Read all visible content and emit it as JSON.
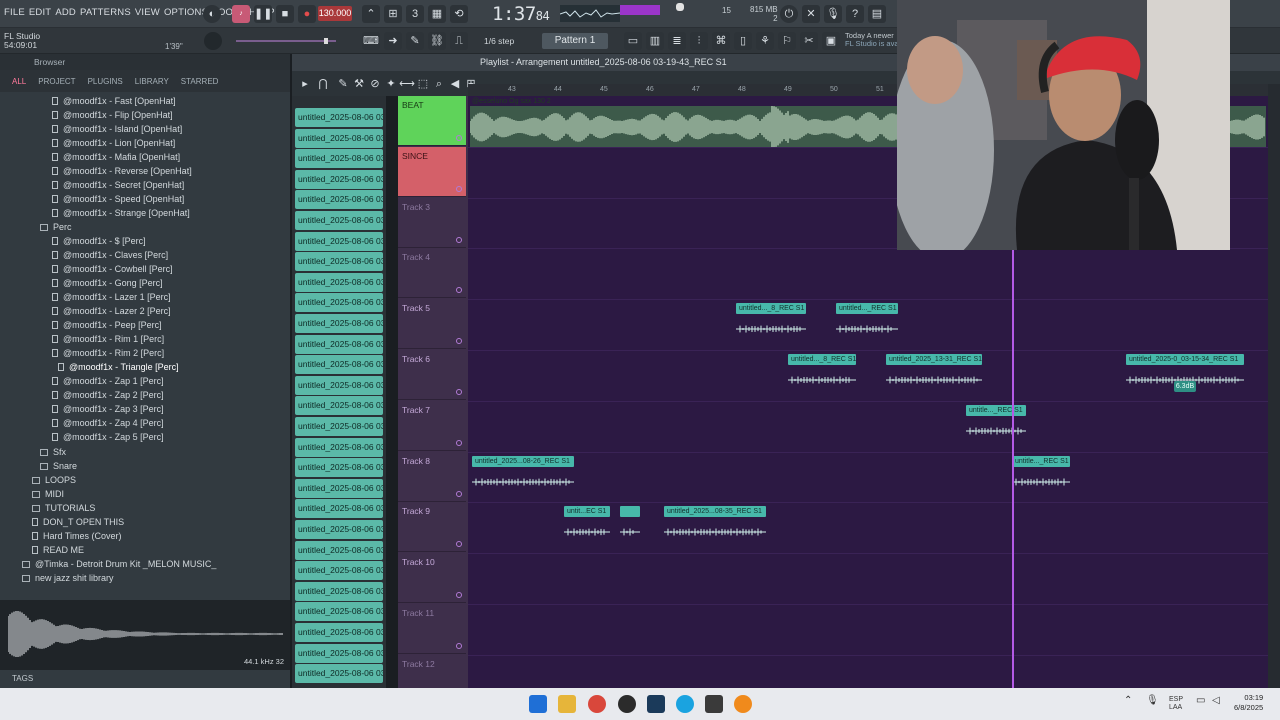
{
  "menu": [
    "FILE",
    "EDIT",
    "ADD",
    "PATTERNS",
    "VIEW",
    "OPTIONS",
    "TOOLS",
    "HELP"
  ],
  "transport": {
    "tempo": "130.000",
    "clock_main": "1:37",
    "clock_frac": "84",
    "mem_top": "815 MB",
    "mem_bottom": "2",
    "val15": "15"
  },
  "project": {
    "app": "FL Studio",
    "time": "54:09:01",
    "hint": "1'39\""
  },
  "toolbar": {
    "step": "1/6 step",
    "pattern": "Pattern 1"
  },
  "news": {
    "line1": "Today  A newer",
    "line2": "FL Studio is ava"
  },
  "browser": {
    "title": "Browser",
    "tabs": [
      "ALL",
      "PROJECT",
      "PLUGINS",
      "LIBRARY",
      "STARRED"
    ],
    "items": [
      {
        "label": "@moodf1x - Fast [OpenHat]",
        "indent": 52,
        "type": "file"
      },
      {
        "label": "@moodf1x - Flip [OpenHat]",
        "indent": 52,
        "type": "file"
      },
      {
        "label": "@moodf1x - Island [OpenHat]",
        "indent": 52,
        "type": "file"
      },
      {
        "label": "@moodf1x - Lion [OpenHat]",
        "indent": 52,
        "type": "file"
      },
      {
        "label": "@moodf1x - Mafia [OpenHat]",
        "indent": 52,
        "type": "file"
      },
      {
        "label": "@moodf1x - Reverse [OpenHat]",
        "indent": 52,
        "type": "file"
      },
      {
        "label": "@moodf1x - Secret [OpenHat]",
        "indent": 52,
        "type": "file"
      },
      {
        "label": "@moodf1x - Speed [OpenHat]",
        "indent": 52,
        "type": "file"
      },
      {
        "label": "@moodf1x - Strange [OpenHat]",
        "indent": 52,
        "type": "file"
      },
      {
        "label": "Perc",
        "indent": 40,
        "type": "folder"
      },
      {
        "label": "@moodf1x - $ [Perc]",
        "indent": 52,
        "type": "file"
      },
      {
        "label": "@moodf1x - Claves [Perc]",
        "indent": 52,
        "type": "file"
      },
      {
        "label": "@moodf1x - Cowbell [Perc]",
        "indent": 52,
        "type": "file"
      },
      {
        "label": "@moodf1x - Gong [Perc]",
        "indent": 52,
        "type": "file"
      },
      {
        "label": "@moodf1x - Lazer 1 [Perc]",
        "indent": 52,
        "type": "file"
      },
      {
        "label": "@moodf1x - Lazer 2 [Perc]",
        "indent": 52,
        "type": "file"
      },
      {
        "label": "@moodf1x - Peep [Perc]",
        "indent": 52,
        "type": "file"
      },
      {
        "label": "@moodf1x - Rim 1 [Perc]",
        "indent": 52,
        "type": "file"
      },
      {
        "label": "@moodf1x - Rim 2 [Perc]",
        "indent": 52,
        "type": "file"
      },
      {
        "label": "@moodf1x - Triangle [Perc]",
        "indent": 58,
        "type": "file",
        "selected": true
      },
      {
        "label": "@moodf1x - Zap 1 [Perc]",
        "indent": 52,
        "type": "file"
      },
      {
        "label": "@moodf1x - Zap 2 [Perc]",
        "indent": 52,
        "type": "file"
      },
      {
        "label": "@moodf1x - Zap 3 [Perc]",
        "indent": 52,
        "type": "file"
      },
      {
        "label": "@moodf1x - Zap 4 [Perc]",
        "indent": 52,
        "type": "file"
      },
      {
        "label": "@moodf1x - Zap 5 [Perc]",
        "indent": 52,
        "type": "file"
      },
      {
        "label": "Sfx",
        "indent": 40,
        "type": "folder"
      },
      {
        "label": "Snare",
        "indent": 40,
        "type": "folder"
      },
      {
        "label": "LOOPS",
        "indent": 32,
        "type": "folder"
      },
      {
        "label": "MIDI",
        "indent": 32,
        "type": "folder"
      },
      {
        "label": "TUTORIALS",
        "indent": 32,
        "type": "folder"
      },
      {
        "label": "DON_T OPEN THIS",
        "indent": 32,
        "type": "file"
      },
      {
        "label": "Hard Times (Cover)",
        "indent": 32,
        "type": "file"
      },
      {
        "label": "READ ME",
        "indent": 32,
        "type": "file"
      },
      {
        "label": "@Timka - Detroit Drum Kit _MELON MUSIC_",
        "indent": 22,
        "type": "folder"
      },
      {
        "label": "new jazz shit library",
        "indent": 22,
        "type": "folder"
      }
    ],
    "preview_rate": "44.1 kHz 32",
    "tags": "TAGS"
  },
  "channels": {
    "label": "untitled_2025-08-06 03-",
    "count": 28
  },
  "playlist": {
    "title": "Playlist - Arrangement  untitled_2025-08-06 03-19-43_REC S1",
    "ruler": [
      "43",
      "44",
      "45",
      "46",
      "47",
      "48",
      "49",
      "50",
      "51"
    ],
    "tracks": [
      {
        "name": "BEAT",
        "style": "beat"
      },
      {
        "name": "SINCE",
        "style": "since"
      },
      {
        "name": "Track 3",
        "style": "dim"
      },
      {
        "name": "Track 4",
        "style": "dim"
      },
      {
        "name": "Track 5",
        "style": ""
      },
      {
        "name": "Track 6",
        "style": ""
      },
      {
        "name": "Track 7",
        "style": ""
      },
      {
        "name": "Track 8",
        "style": ""
      },
      {
        "name": "Track 9",
        "style": ""
      },
      {
        "name": "Track 10",
        "style": ""
      },
      {
        "name": "Track 11",
        "style": "dim"
      },
      {
        "name": "Track 12",
        "style": "dim"
      }
    ],
    "beat_clip_label": "@esseluno Og sax 130 2",
    "clips": [
      {
        "label": "untitled..._8_REC S1",
        "track": 4,
        "start": 268,
        "width": 70
      },
      {
        "label": "untitled..._REC S1",
        "track": 4,
        "start": 368,
        "width": 62
      },
      {
        "label": "untitled..._8_REC S1",
        "track": 5,
        "start": 320,
        "width": 68
      },
      {
        "label": "untitled_2025_13-31_REC S1",
        "track": 5,
        "start": 418,
        "width": 96
      },
      {
        "label": "untitled_2025-0_03-15-34_REC S1",
        "track": 5,
        "start": 658,
        "width": 118
      },
      {
        "label": "untitle..._REC S1",
        "track": 6,
        "start": 498,
        "width": 60
      },
      {
        "label": "untitled_2025...08-26_REC S1",
        "track": 7,
        "start": 4,
        "width": 102
      },
      {
        "label": "untitle..._REC S1",
        "track": 7,
        "start": 544,
        "width": 58
      },
      {
        "label": "untit...EC S1",
        "track": 8,
        "start": 96,
        "width": 46
      },
      {
        "label": "",
        "track": 8,
        "start": 152,
        "width": 20
      },
      {
        "label": "untitled_2025...08-35_REC S1",
        "track": 8,
        "start": 196,
        "width": 102
      }
    ],
    "volume_popup": "6.3dB"
  },
  "taskbar": {
    "lang1": "ESP",
    "lang2": "LAA",
    "time": "03:19",
    "date": "6/8/2025"
  },
  "colors": {
    "accent": "#b45ae6",
    "clip": "#47b8aa",
    "lane_bg": "#2c1943",
    "beat_track": "#5fd35a",
    "since_track": "#d46069"
  }
}
